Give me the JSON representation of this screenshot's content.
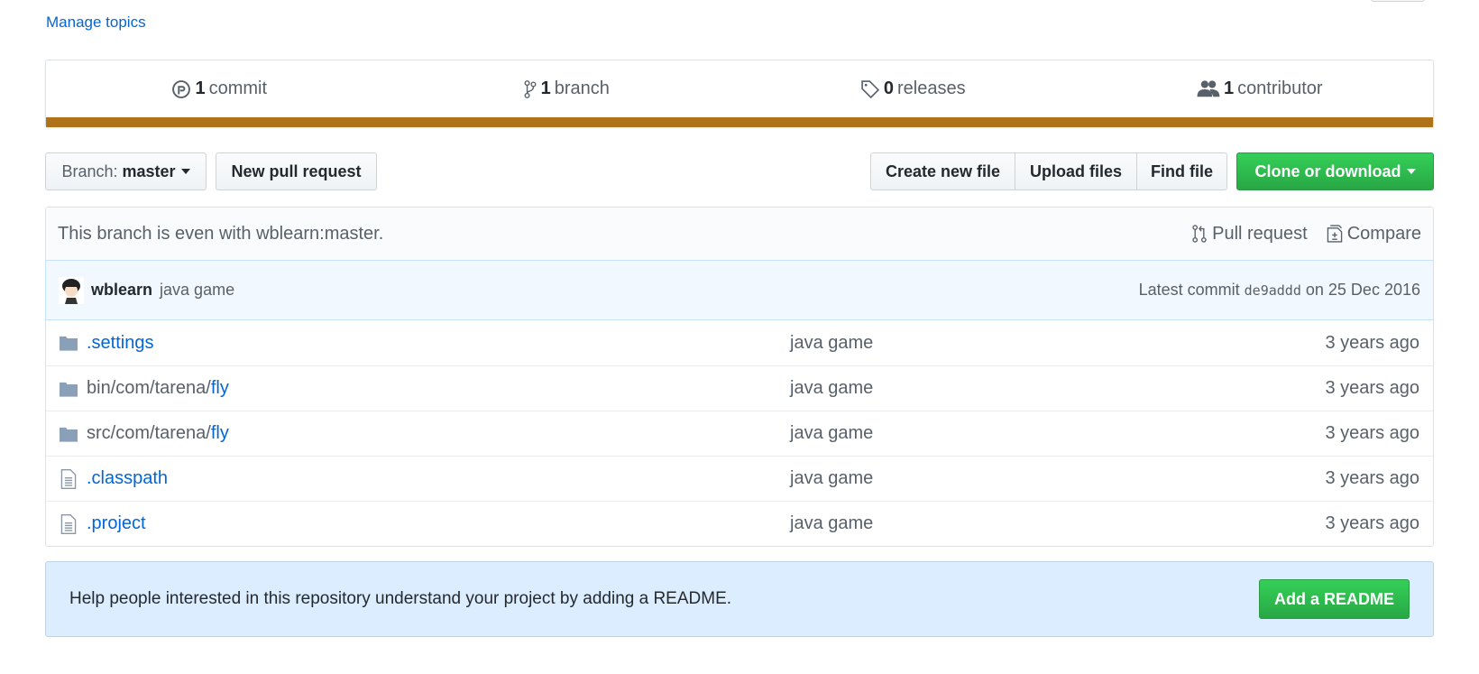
{
  "manage_topics": "Manage topics",
  "stats": [
    {
      "icon": "history-icon",
      "count": "1",
      "label": "commit"
    },
    {
      "icon": "branch-icon",
      "count": "1",
      "label": "branch"
    },
    {
      "icon": "tag-icon",
      "count": "0",
      "label": "releases"
    },
    {
      "icon": "people-icon",
      "count": "1",
      "label": "contributor"
    }
  ],
  "language_color": "#b07219",
  "toolbar": {
    "branch_prefix": "Branch:",
    "branch": "master",
    "new_pr": "New pull request",
    "create_file": "Create new file",
    "upload": "Upload files",
    "find": "Find file",
    "clone": "Clone or download"
  },
  "branch_info": {
    "text": "This branch is even with wblearn:master.",
    "pull_request": "Pull request",
    "compare": "Compare"
  },
  "latest_commit": {
    "author": "wblearn",
    "message": "java game",
    "prefix": "Latest commit",
    "sha": "de9addd",
    "date": "on 25 Dec 2016"
  },
  "files": [
    {
      "type": "dir",
      "prefix": "",
      "name": ".settings",
      "message": "java game",
      "age": "3 years ago"
    },
    {
      "type": "dir",
      "prefix": "bin/com/tarena/",
      "name": "fly",
      "message": "java game",
      "age": "3 years ago"
    },
    {
      "type": "dir",
      "prefix": "src/com/tarena/",
      "name": "fly",
      "message": "java game",
      "age": "3 years ago"
    },
    {
      "type": "file",
      "prefix": "",
      "name": ".classpath",
      "message": "java game",
      "age": "3 years ago"
    },
    {
      "type": "file",
      "prefix": "",
      "name": ".project",
      "message": "java game",
      "age": "3 years ago"
    }
  ],
  "readme": {
    "text": "Help people interested in this repository understand your project by adding a README.",
    "button": "Add a README"
  }
}
